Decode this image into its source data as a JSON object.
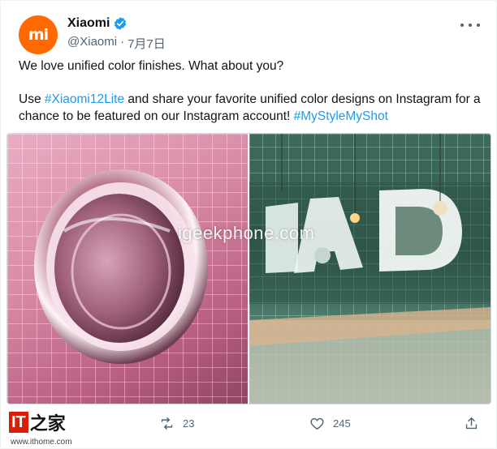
{
  "author": {
    "name": "Xiaomi",
    "handle": "@Xiaomi",
    "separator": "·",
    "date": "7月7日",
    "avatar_text": "mi",
    "brand_color": "#ff6900",
    "verified_color": "#1d9bf0"
  },
  "tweet": {
    "line1": "We love unified color finishes. What about you?",
    "line2_prefix": "Use ",
    "hashtag1": "#Xiaomi12Lite",
    "line2_mid": " and share your favorite unified color designs on Instagram for a chance to be featured on our Instagram account! ",
    "hashtag2": "#MyStyleMyShot",
    "link_color": "#1d9bf0"
  },
  "media": {
    "watermark": "igeekphone.com",
    "left_image": "pink-tile-wall-round-mirror",
    "right_image": "green-tile-restaurant-illuminated-letters"
  },
  "actions": {
    "reply_count": "",
    "retweet_count": "23",
    "like_count": "245"
  },
  "source": {
    "logo_it": "IT",
    "logo_zh": "之家",
    "site": "www.ithome.com"
  }
}
